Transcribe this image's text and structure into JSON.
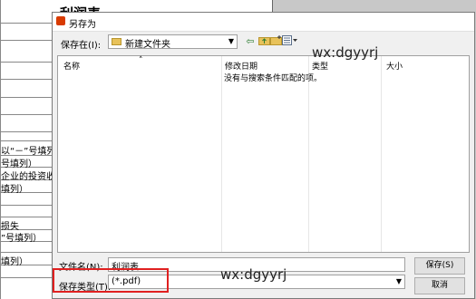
{
  "document": {
    "title": "利润表",
    "fragments": [
      "以“－”号填列",
      "号填列）",
      "企业的投资收益",
      "填列）",
      "损失",
      "”号填列）",
      "填列）"
    ]
  },
  "dialog": {
    "title": "另存为",
    "save_in_label": "保存在(I):",
    "save_in_value": "新建文件夹",
    "columns": [
      "名称",
      "修改日期",
      "类型",
      "大小"
    ],
    "empty_message": "没有与搜索条件匹配的项。",
    "filename_label": "文件名(N):",
    "filename_value": "利润表",
    "filetype_label": "保存类型(T):",
    "filetype_value": "(*.pdf)",
    "save_button": "保存(S)",
    "cancel_button": "取消"
  },
  "watermarks": [
    "wx:dgyyrj",
    "wx:dgyyrj"
  ],
  "colors": {
    "highlight": "#e02020",
    "folder": "#e8c25a"
  }
}
